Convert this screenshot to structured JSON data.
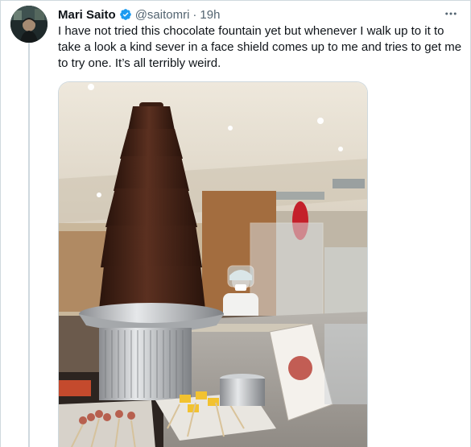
{
  "tweet": {
    "display_name": "Mari Saito",
    "handle": "@saitomri",
    "separator": "·",
    "time": "19h",
    "text": "I have not tried this chocolate fountain yet but whenever I walk up to it to take a look a kind sever in a face shield comes up to me and tries to get me to try one. It’s all terribly weird."
  },
  "icons": {
    "verified": "verified-badge-icon",
    "more": "more-horizontal-icon"
  },
  "colors": {
    "text": "#0f1419",
    "secondary": "#536471",
    "verified": "#1d9bf0",
    "border": "#cfd9de"
  }
}
